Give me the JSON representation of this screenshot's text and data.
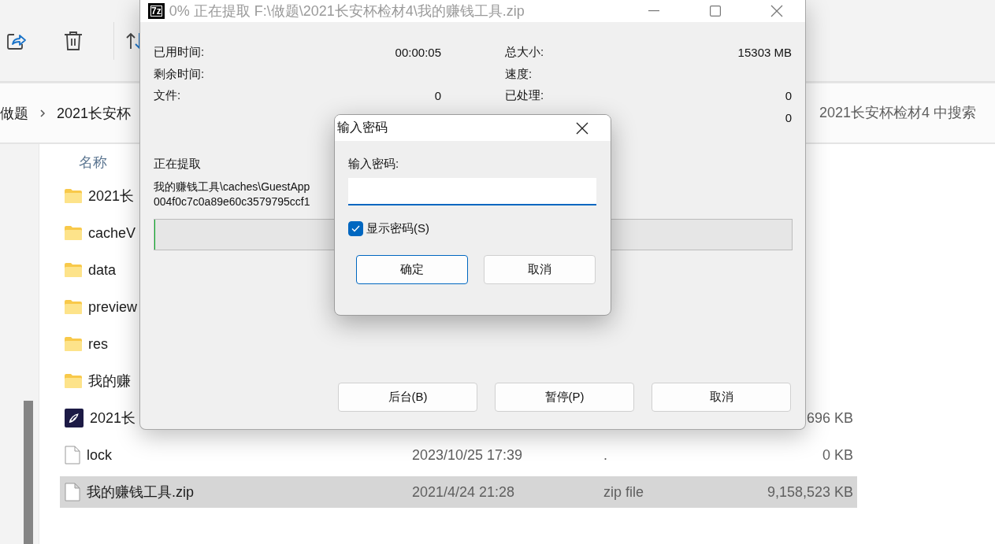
{
  "explorer": {
    "breadcrumb": [
      "做题",
      "2021长安杯"
    ],
    "search": {
      "placeholder": "2021长安杯检材4 中搜索"
    },
    "columns": [
      "名称"
    ],
    "files": [
      {
        "kind": "folder",
        "name": "2021长",
        "selected": false
      },
      {
        "kind": "folder",
        "name": "cacheV",
        "selected": false
      },
      {
        "kind": "folder",
        "name": "data",
        "selected": false
      },
      {
        "kind": "folder",
        "name": "preview",
        "selected": false
      },
      {
        "kind": "folder",
        "name": "res",
        "selected": false
      },
      {
        "kind": "folder",
        "name": "我的赚",
        "selected": false
      },
      {
        "kind": "app",
        "name": "2021长",
        "size": "696 KB",
        "selected": false
      },
      {
        "kind": "file",
        "name": "lock",
        "date": "2023/10/25 17:39",
        "type": ".",
        "size": "0 KB",
        "selected": false
      },
      {
        "kind": "file",
        "name": "我的赚钱工具.zip",
        "date": "2021/4/24 21:28",
        "type": "zip file",
        "size": "9,158,523 KB",
        "selected": true
      }
    ]
  },
  "extract_window": {
    "logo": "7z",
    "title": "0% 正在提取 F:\\做题\\2021长安杯检材4\\我的赚钱工具.zip",
    "stats_left": [
      {
        "label": "已用时间:",
        "value": "00:00:05"
      },
      {
        "label": "剩余时间:"
      },
      {
        "label": "文件:",
        "value": "0"
      }
    ],
    "stats_right": [
      {
        "label": "总大小:",
        "value": "15303 MB"
      },
      {
        "label": "速度:"
      },
      {
        "label": "已处理:",
        "value": "0"
      },
      {
        "value": "0"
      }
    ],
    "status_label": "正在提取",
    "path_lines": [
      "我的赚钱工具\\caches\\GuestApp",
      "004f0c7c0a89e60c3579795ccf1"
    ],
    "progress": {
      "level": 0
    },
    "buttons": [
      "后台(B)",
      "暂停(P)",
      "取消"
    ]
  },
  "password_dialog": {
    "title": "输入密码",
    "field_label": "输入密码:",
    "show_password": {
      "label": "显示密码(S)",
      "checked": true
    },
    "buttons": [
      {
        "label": "确定",
        "default": true
      },
      {
        "label": "取消",
        "default": false
      }
    ]
  }
}
